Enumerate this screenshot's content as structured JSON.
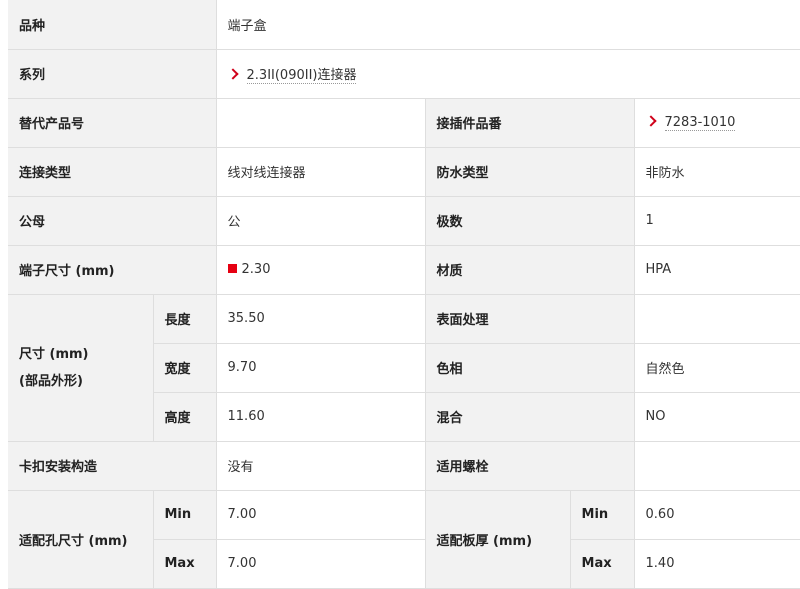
{
  "rows": {
    "variety": {
      "label": "品种",
      "value": "端子盒"
    },
    "series": {
      "label": "系列",
      "value": "2.3II(090II)连接器"
    },
    "alt_product": {
      "label": "替代产品号",
      "value": ""
    },
    "mating_part": {
      "label": "接插件品番",
      "value": "7283-1010"
    },
    "connection_type": {
      "label": "连接类型",
      "value": "线对线连接器"
    },
    "waterproof_type": {
      "label": "防水类型",
      "value": "非防水"
    },
    "gender": {
      "label": "公母",
      "value": "公"
    },
    "poles": {
      "label": "极数",
      "value": "1"
    },
    "terminal_size": {
      "label": "端子尺寸 (mm)",
      "value": "2.30",
      "marker_color": "#e60012"
    },
    "material": {
      "label": "材质",
      "value": "HPA"
    },
    "dimensions": {
      "label_line1": "尺寸 (mm)",
      "label_line2": "(部品外形)",
      "length_label": "長度",
      "length": "35.50",
      "width_label": "宽度",
      "width": "9.70",
      "height_label": "高度",
      "height": "11.60"
    },
    "surface_treatment": {
      "label": "表面处理",
      "value": ""
    },
    "hue": {
      "label": "色相",
      "value": "自然色"
    },
    "mixed": {
      "label": "混合",
      "value": "NO"
    },
    "clip_structure": {
      "label": "卡扣安装构造",
      "value": "没有"
    },
    "bolt": {
      "label": "适用螺栓",
      "value": ""
    },
    "hole_size": {
      "label": "适配孔尺寸 (mm)",
      "min_label": "Min",
      "min": "7.00",
      "max_label": "Max",
      "max": "7.00"
    },
    "panel_thickness": {
      "label": "适配板厚 (mm)",
      "min_label": "Min",
      "min": "0.60",
      "max_label": "Max",
      "max": "1.40"
    }
  },
  "colors": {
    "accent": "#d0021b",
    "label_bg": "#f2f2f2",
    "border": "#dedede"
  }
}
